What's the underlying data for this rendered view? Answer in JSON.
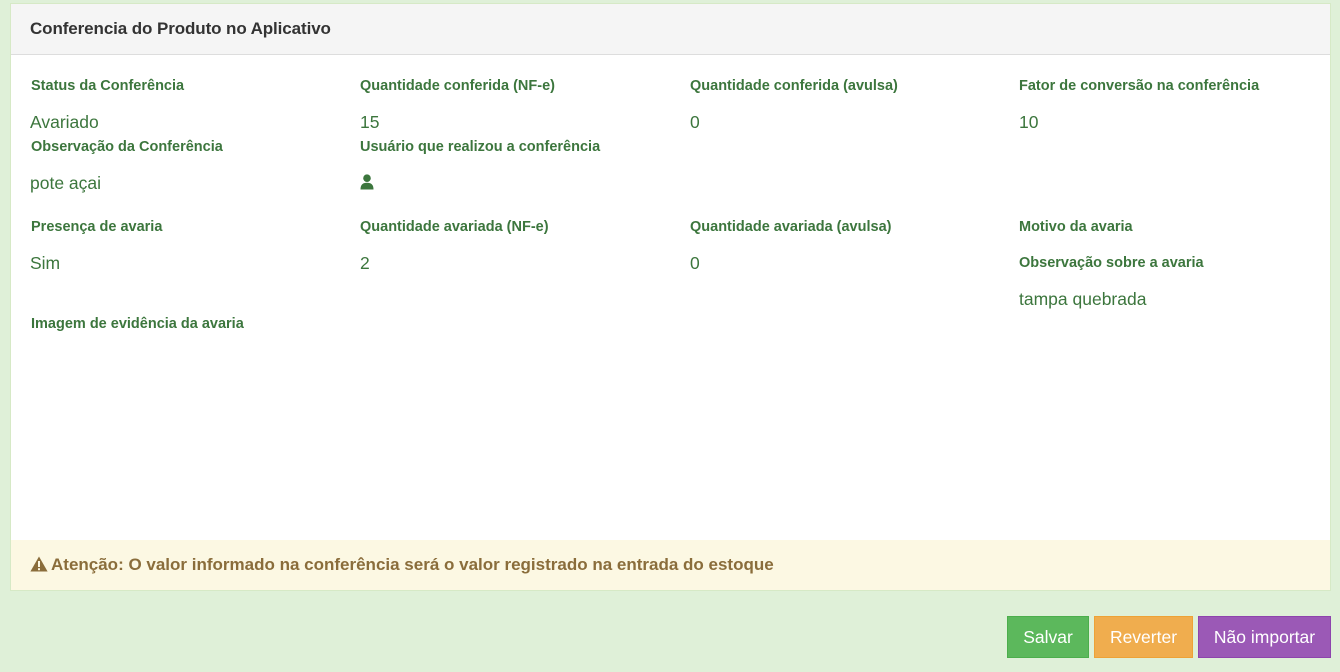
{
  "panel": {
    "title": "Conferencia do Produto no Aplicativo"
  },
  "fields": {
    "status": {
      "label": "Status da Conferência",
      "value": "Avariado"
    },
    "qtd_nfe": {
      "label": "Quantidade conferida (NF-e)",
      "value": "15"
    },
    "qtd_avulsa": {
      "label": "Quantidade conferida (avulsa)",
      "value": "0"
    },
    "fator": {
      "label": "Fator de conversão na conferência",
      "value": "10"
    },
    "observacao": {
      "label": "Observação da Conferência",
      "value": "pote açai"
    },
    "usuario": {
      "label": "Usuário que realizou a conferência",
      "icon": "user-icon"
    },
    "presenca_avaria": {
      "label": "Presença de avaria",
      "value": "Sim"
    },
    "qtd_avariada_nfe": {
      "label": "Quantidade avariada (NF-e)",
      "value": "2"
    },
    "qtd_avariada_avulsa": {
      "label": "Quantidade avariada (avulsa)",
      "value": "0"
    },
    "motivo_avaria": {
      "label": "Motivo da avaria",
      "value": ""
    },
    "obs_avaria": {
      "label": "Observação sobre a avaria",
      "value": "tampa quebrada"
    },
    "imagem_avaria": {
      "label": "Imagem de evidência da avaria"
    }
  },
  "alert": {
    "icon": "warning-icon",
    "text": "Atenção: O valor informado na conferência será o valor registrado na entrada do estoque"
  },
  "buttons": {
    "salvar": "Salvar",
    "reverter": "Reverter",
    "nao_importar": "Não importar"
  },
  "colors": {
    "page_bg": "#dff0d8",
    "label_green": "#3c763d",
    "alert_bg": "#fcf8e3",
    "alert_text": "#8a6d3b",
    "salvar": "#5cb85c",
    "reverter": "#f0ad4e",
    "nao_importar": "#9b59b6"
  }
}
